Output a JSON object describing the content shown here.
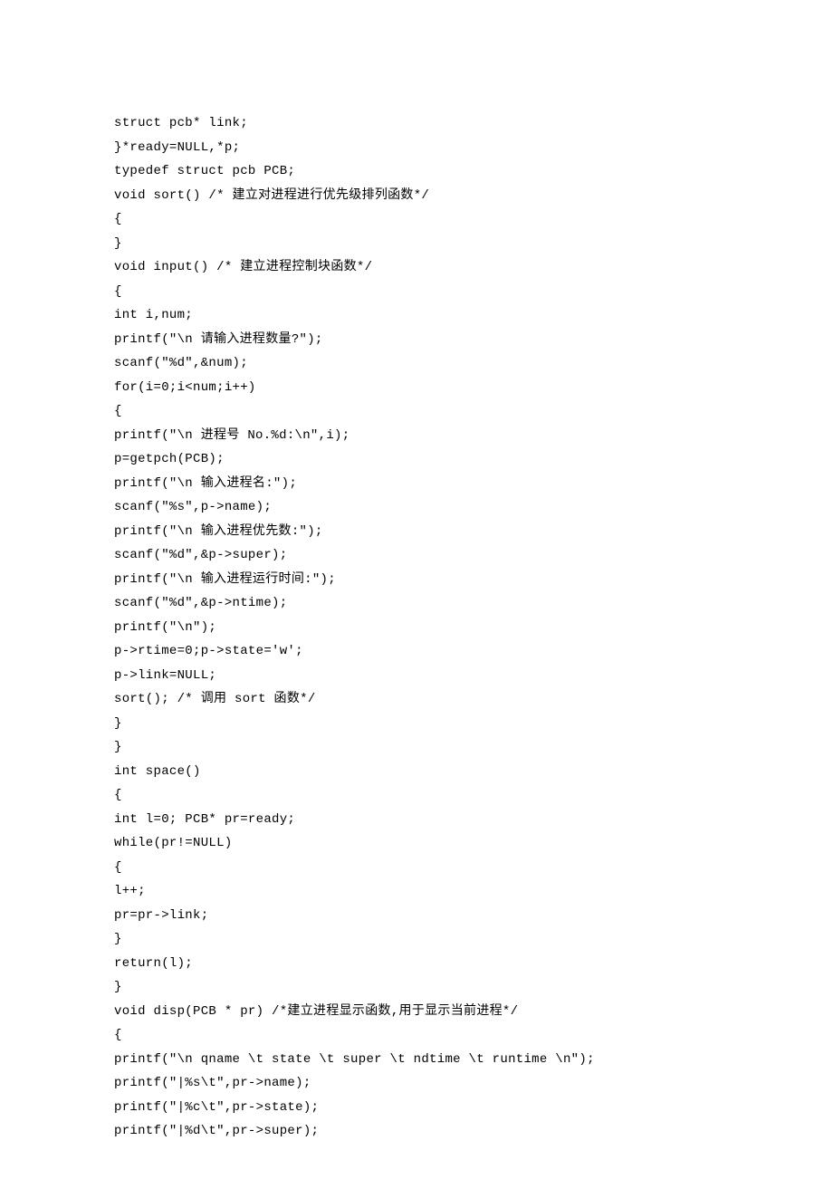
{
  "code_lines": [
    "struct pcb* link;",
    "}*ready=NULL,*p;",
    "typedef struct pcb PCB;",
    "void sort() /* 建立对进程进行优先级排列函数*/",
    "{",
    "}",
    "void input() /* 建立进程控制块函数*/",
    "{",
    "int i,num;",
    "printf(\"\\n 请输入进程数量?\");",
    "scanf(\"%d\",&num);",
    "for(i=0;i<num;i++)",
    "{",
    "printf(\"\\n 进程号 No.%d:\\n\",i);",
    "p=getpch(PCB);",
    "printf(\"\\n 输入进程名:\");",
    "scanf(\"%s\",p->name);",
    "printf(\"\\n 输入进程优先数:\");",
    "scanf(\"%d\",&p->super);",
    "printf(\"\\n 输入进程运行时间:\");",
    "scanf(\"%d\",&p->ntime);",
    "printf(\"\\n\");",
    "p->rtime=0;p->state='w';",
    "p->link=NULL;",
    "sort(); /* 调用 sort 函数*/",
    "}",
    "}",
    "int space()",
    "{",
    "int l=0; PCB* pr=ready;",
    "while(pr!=NULL)",
    "{",
    "l++;",
    "pr=pr->link;",
    "}",
    "return(l);",
    "}",
    "void disp(PCB * pr) /*建立进程显示函数,用于显示当前进程*/",
    "{",
    "printf(\"\\n qname \\t state \\t super \\t ndtime \\t runtime \\n\");",
    "printf(\"|%s\\t\",pr->name);",
    "printf(\"|%c\\t\",pr->state);",
    "printf(\"|%d\\t\",pr->super);"
  ]
}
